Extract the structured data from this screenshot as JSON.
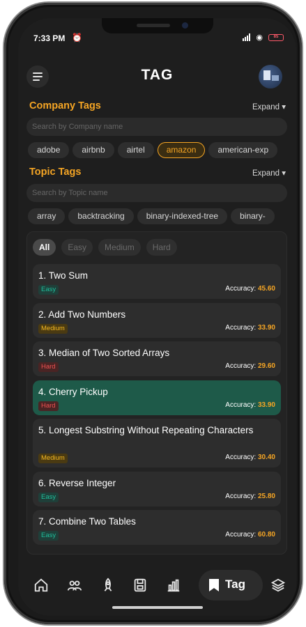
{
  "status_bar": {
    "time": "7:33 PM",
    "battery": "85"
  },
  "header": {
    "title": "TAG"
  },
  "company_section": {
    "title": "Company Tags",
    "expand_label": "Expand ▾",
    "search_placeholder": "Search by Company name",
    "chips": [
      "adobe",
      "airbnb",
      "airtel",
      "amazon",
      "american-exp"
    ],
    "selected_chip": "amazon"
  },
  "topic_section": {
    "title": "Topic Tags",
    "expand_label": "Expand ▾",
    "search_placeholder": "Search by Topic name",
    "chips": [
      "array",
      "backtracking",
      "binary-indexed-tree",
      "binary-"
    ]
  },
  "filters": [
    "All",
    "Easy",
    "Medium",
    "Hard"
  ],
  "active_filter": "All",
  "accuracy_label": "Accuracy:",
  "questions": [
    {
      "title": "1. Two Sum",
      "difficulty": "Easy",
      "accuracy": "45.60"
    },
    {
      "title": "2. Add Two Numbers",
      "difficulty": "Medium",
      "accuracy": "33.90"
    },
    {
      "title": "3. Median of Two Sorted Arrays",
      "difficulty": "Hard",
      "accuracy": "29.60"
    },
    {
      "title": "4. Cherry Pickup",
      "difficulty": "Hard",
      "accuracy": "33.90",
      "highlighted": true
    },
    {
      "title": "5. Longest Substring Without Repeating Characters",
      "difficulty": "Medium",
      "accuracy": "30.40"
    },
    {
      "title": "6. Reverse Integer",
      "difficulty": "Easy",
      "accuracy": "25.80"
    },
    {
      "title": "7. Combine Two Tables",
      "difficulty": "Easy",
      "accuracy": "60.80"
    }
  ],
  "bottom_nav": {
    "items": [
      "home-icon",
      "users-icon",
      "rocket-icon",
      "save-icon",
      "chart-icon",
      "tag-icon",
      "layers-icon"
    ],
    "active_label": "Tag"
  },
  "colors": {
    "accent": "#f5a524",
    "easy": "#1fbf9c",
    "medium": "#f5b820",
    "hard": "#f05252",
    "highlight_card": "#1e5a49"
  }
}
